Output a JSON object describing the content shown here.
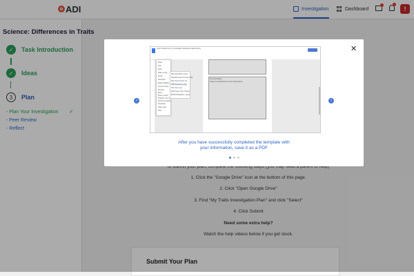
{
  "header": {
    "logo_text": "ADI",
    "nav": [
      {
        "label": "Investigation",
        "icon": "book-icon",
        "active": true
      },
      {
        "label": "Dashboard",
        "icon": "grid-icon",
        "active": false
      }
    ],
    "alert_label": "!"
  },
  "sidebar": {
    "title": "Science: Differences in Traits",
    "steps": [
      {
        "label": "Task Introduction",
        "status": "complete",
        "marker": "✓"
      },
      {
        "label": "Ideas",
        "status": "complete",
        "marker": "✓"
      },
      {
        "label": "Plan",
        "status": "current",
        "marker": "3"
      }
    ],
    "substeps": [
      {
        "label": "- Plan Your Investigation",
        "active": true
      },
      {
        "label": "- Peer Review",
        "active": false
      },
      {
        "label": "- Reflect",
        "active": false
      }
    ],
    "check_mark": "✓"
  },
  "main": {
    "partial_line": "to submit your plan, complete the following steps (you may need a parent to help)",
    "instructions": [
      "1. Click the \"Google Drive\" icon at the bottom of this page.",
      "2. Click \"Open Google Drive\"",
      "3. Find \"My Traits Investigation Plan\" and click \"Select\"",
      "4. Click Submit"
    ],
    "help_heading": "Need some extra help?",
    "help_text": "Watch the help videos below if you get stuck.",
    "submit_card_title": "Submit Your Plan"
  },
  "modal": {
    "close_label": "✕",
    "prev_label": "‹",
    "next_label": "›",
    "caption_line1": "After you have successfully completed the template with",
    "caption_line2": "your information, save it as a PDF",
    "dots": [
      true,
      false,
      false
    ],
    "screenshot": {
      "doc_title": "Copy of Data from my Investigation Worksheet (Elementary)",
      "menu_items": [
        "Share",
        "New",
        "Open",
        "Make a copy",
        "Email",
        "Download",
        "Make available offline",
        "Version history",
        "Rename",
        "Move",
        "Move to trash",
        "Publish to the web",
        "Document details",
        "Language",
        "Page setup",
        "Print"
      ],
      "submenu_items": [
        "Microsoft Word (.docx)",
        "OpenDocument Format (.odt)",
        "Rich Text Format (.rtf)",
        "PDF Document (.pdf)",
        "Plain Text (.txt)",
        "Web Page (.html, zipped)",
        "EPUB Publication (.epub)"
      ],
      "box_text_1": "My observations:",
      "box_text_2": "Image or sketch/labeled of your observations"
    }
  }
}
